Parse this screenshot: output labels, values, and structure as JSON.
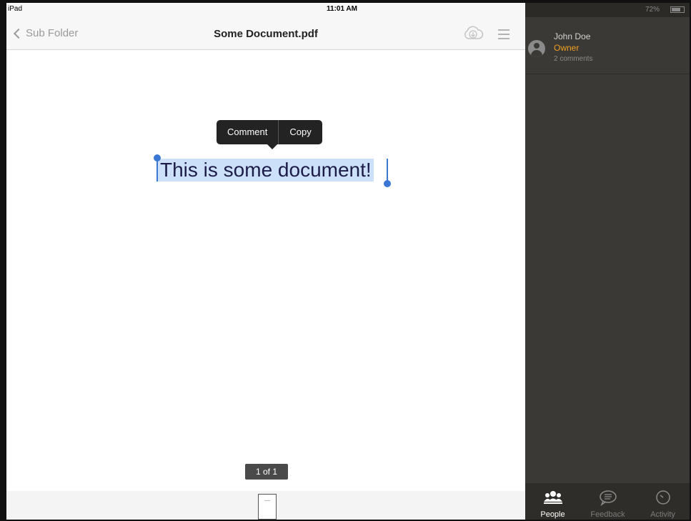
{
  "status_bar": {
    "carrier": "iPad",
    "time": "11:01 AM",
    "battery": "72%"
  },
  "nav": {
    "back_label": "Sub Folder",
    "title": "Some Document.pdf",
    "icons": [
      "download-cloud-icon",
      "menu-icon"
    ]
  },
  "popover": {
    "comment_label": "Comment",
    "copy_label": "Copy"
  },
  "document": {
    "text": "This is some document!"
  },
  "pagination": {
    "indicator": "1 of 1",
    "current_page": 1,
    "total_pages": 1
  },
  "side_panel": {
    "user": {
      "name": "John Doe",
      "role": "Owner",
      "comments": "2 comments"
    },
    "tabs": [
      {
        "label": "People",
        "icon": "people-icon",
        "active": true
      },
      {
        "label": "Feedback",
        "icon": "feedback-icon",
        "active": false
      },
      {
        "label": "Activity",
        "icon": "activity-icon",
        "active": false
      }
    ]
  },
  "colors": {
    "selection": "#cde0fa",
    "handle": "#3b78d6",
    "owner": "#f0a020",
    "panel": "#3b3935"
  }
}
